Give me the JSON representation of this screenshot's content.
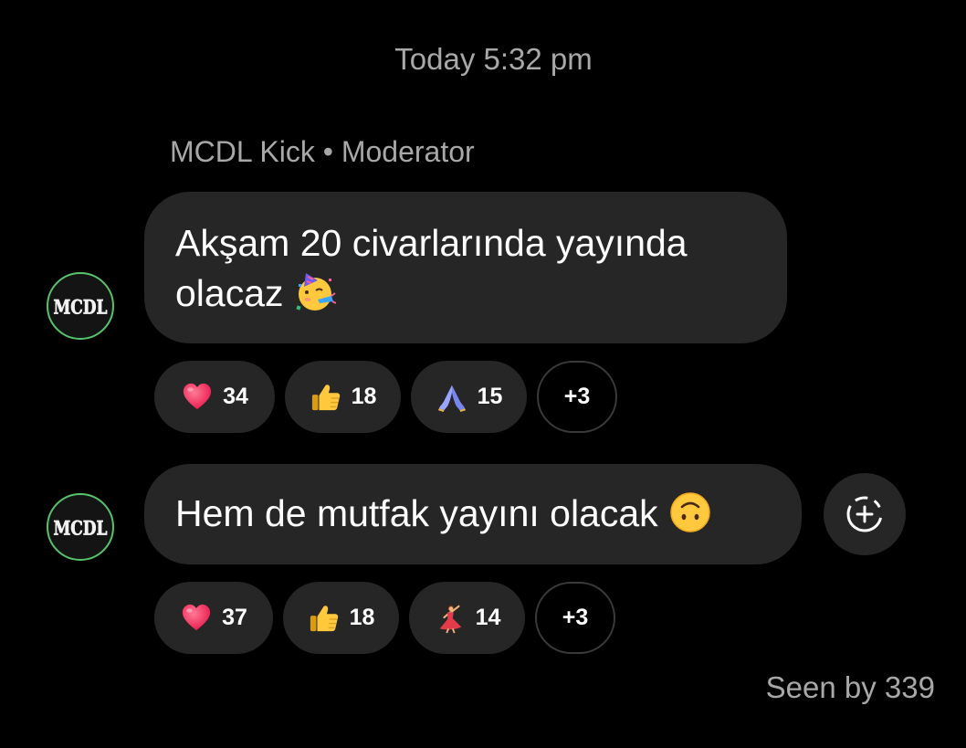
{
  "timestamp": "Today 5:32 pm",
  "sender": {
    "name": "MCDL Kick",
    "separator": "•",
    "role": "Moderator",
    "avatar_text": "MCDL",
    "avatar_ring_color": "#58c26a"
  },
  "messages": [
    {
      "line1": "Akşam 20 civarlarında yayında",
      "line2": "olacaz",
      "emoji": "partying-face",
      "reactions": [
        {
          "emoji": "red-heart",
          "count": "34"
        },
        {
          "emoji": "thumbs-up",
          "count": "18"
        },
        {
          "emoji": "folded-hands",
          "count": "15"
        }
      ],
      "more": "+3"
    },
    {
      "text": "Hem de mutfak yayını olacak",
      "emoji": "upside-down-face",
      "reactions": [
        {
          "emoji": "red-heart",
          "count": "37"
        },
        {
          "emoji": "thumbs-up",
          "count": "18"
        },
        {
          "emoji": "woman-dancing",
          "count": "14"
        }
      ],
      "more": "+3"
    }
  ],
  "add_reaction_icon": "add-reaction-icon",
  "seen": "Seen by 339",
  "colors": {
    "background": "#000000",
    "bubble": "#262626",
    "muted_text": "#a8a8a8"
  }
}
